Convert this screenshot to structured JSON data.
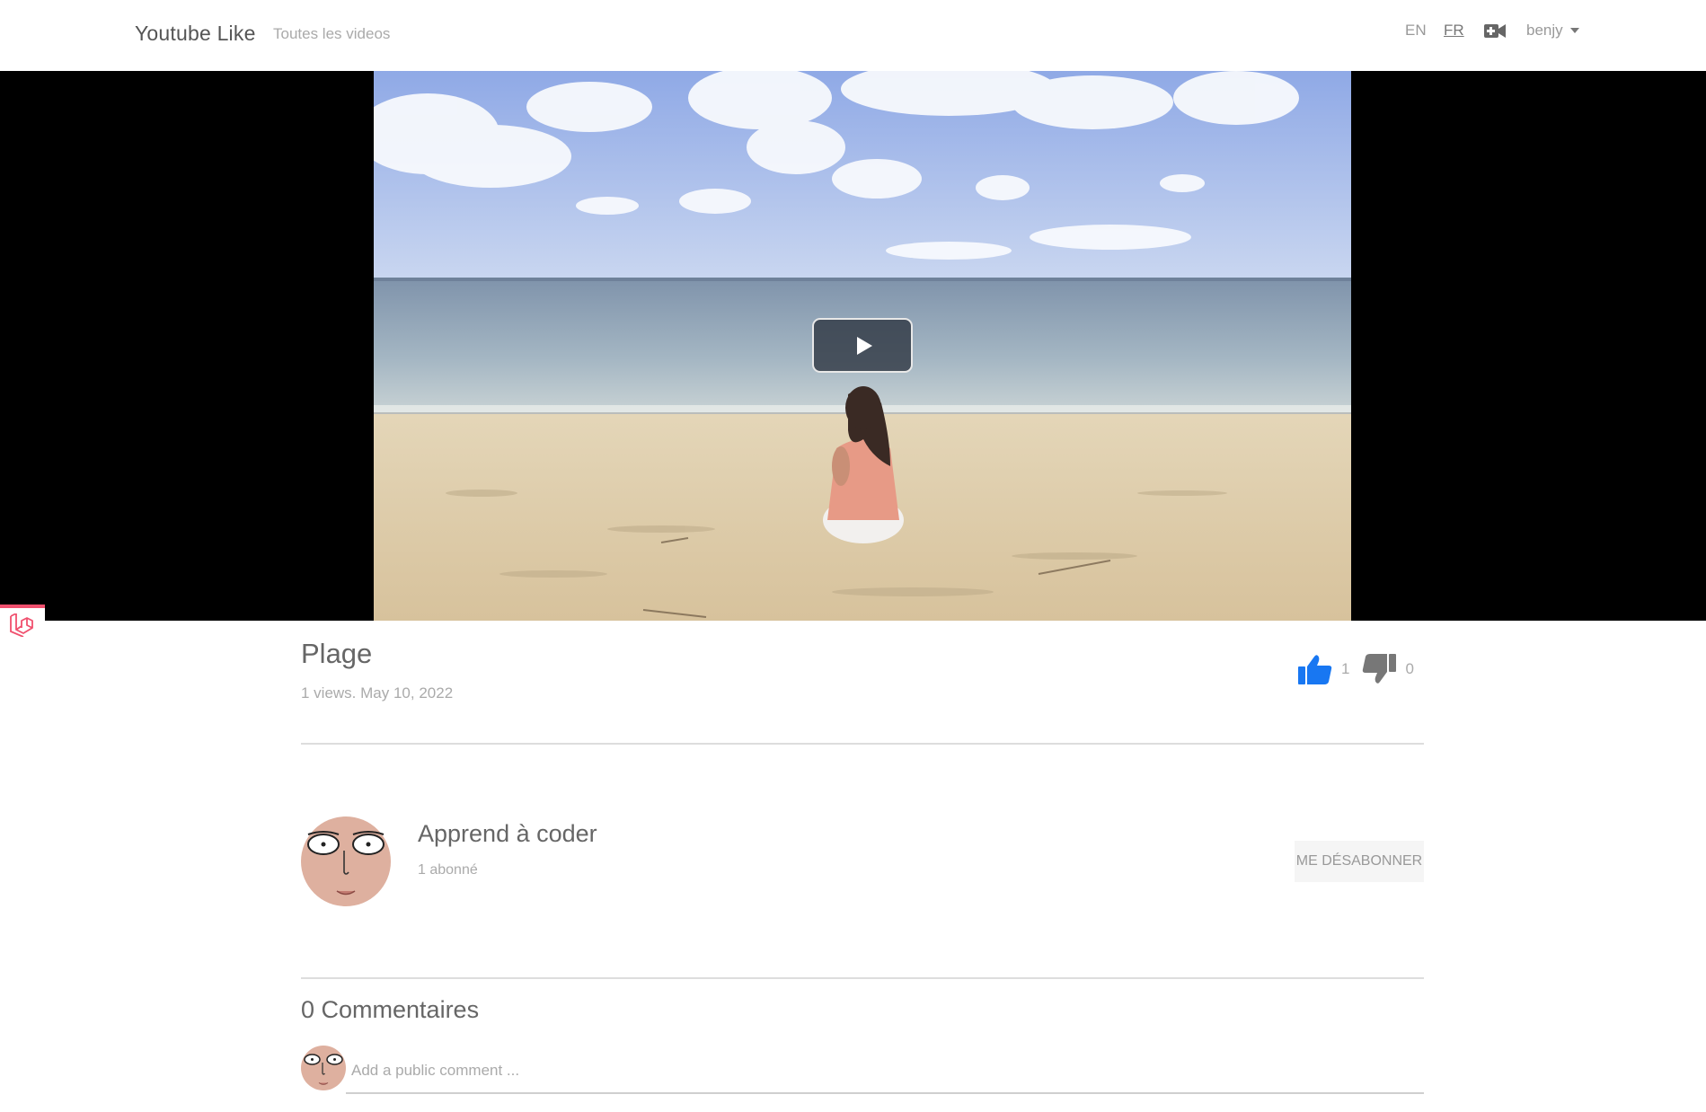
{
  "navbar": {
    "brand": "Youtube Like",
    "all_videos": "Toutes les videos",
    "lang_en": "EN",
    "lang_fr": "FR",
    "upload_icon": "video-plus-icon",
    "user": "benjy"
  },
  "video": {
    "title": "Plage",
    "meta": "1 views. May 10, 2022",
    "likes": "1",
    "dislikes": "0",
    "play_icon": "play-icon",
    "like_color": "#1877f2",
    "dislike_color": "#777777"
  },
  "channel": {
    "name": "Apprend à coder",
    "subscribers": "1 abonné",
    "unsubscribe_label": "ME DÉSABONNER"
  },
  "comments": {
    "title": "0 Commentaires",
    "placeholder": "Add a public comment ..."
  },
  "colors": {
    "debug_accent": "#f0506e",
    "avatar_skin": "#deb09f"
  }
}
